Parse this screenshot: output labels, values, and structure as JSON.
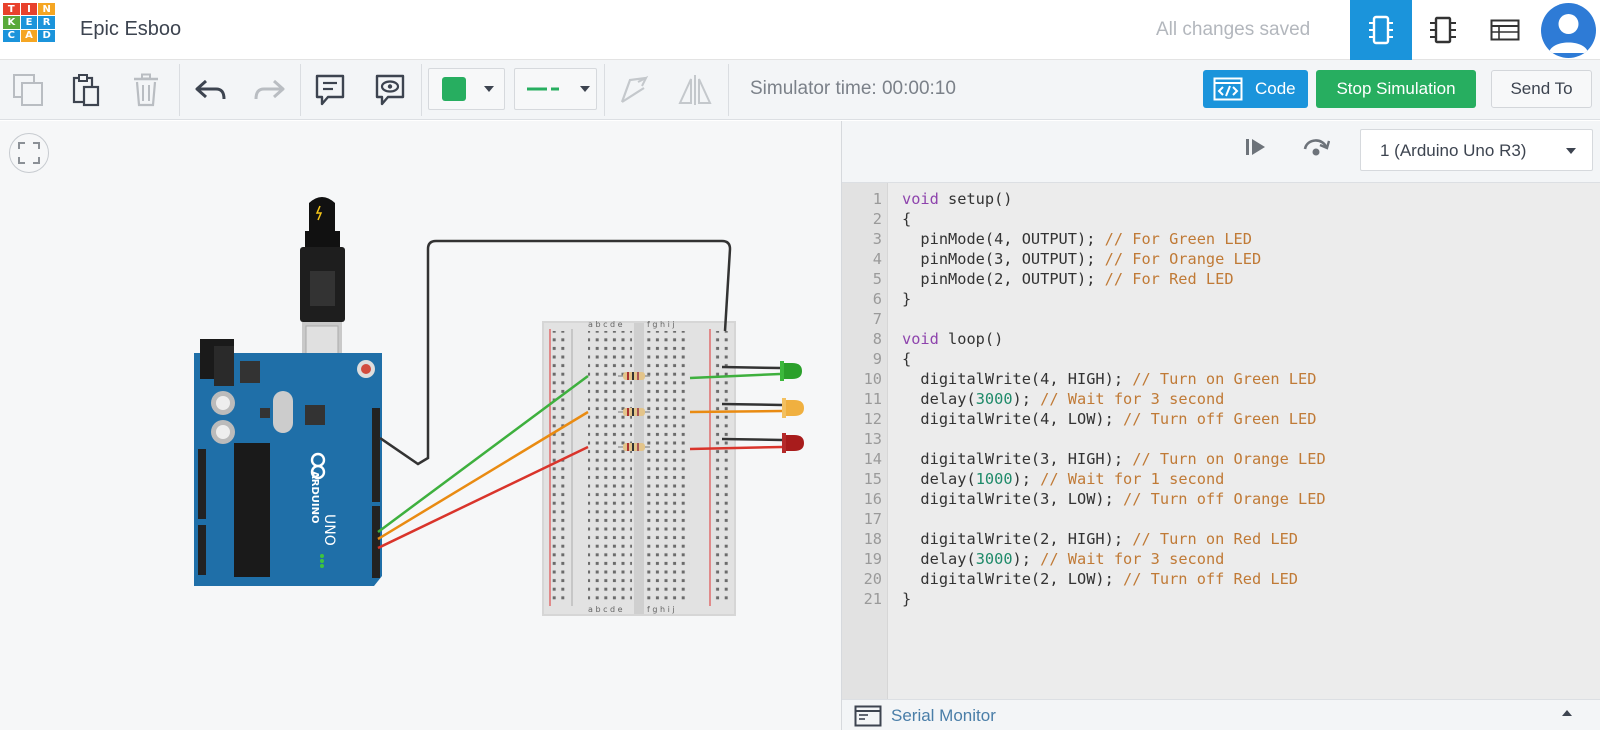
{
  "header": {
    "logo_letters": [
      "T",
      "I",
      "N",
      "K",
      "E",
      "R",
      "C",
      "A",
      "D"
    ],
    "project_title": "Epic Esboo",
    "save_status": "All changes saved",
    "view_buttons": [
      {
        "name": "circuit-view-icon",
        "active": true
      },
      {
        "name": "schematic-view-icon",
        "active": false
      },
      {
        "name": "component-list-icon",
        "active": false
      }
    ]
  },
  "toolbar": {
    "simulator_time": "Simulator time: 00:00:10",
    "code_label": "Code",
    "stop_label": "Stop Simulation",
    "send_label": "Send To",
    "wire_color": "#27ae60"
  },
  "code_panel": {
    "device": "1 (Arduino Uno R3)",
    "serial_label": "Serial Monitor",
    "line_numbers": [
      "1",
      "2",
      "3",
      "4",
      "5",
      "6",
      "7",
      "8",
      "9",
      "10",
      "11",
      "12",
      "13",
      "14",
      "15",
      "16",
      "17",
      "18",
      "19",
      "20",
      "21"
    ]
  },
  "circuit": {
    "arduino_brand": "ARDUINO",
    "arduino_model": "UNO",
    "breadboard_columns_left": "a b c d e",
    "breadboard_columns_right": "f g h i j"
  }
}
